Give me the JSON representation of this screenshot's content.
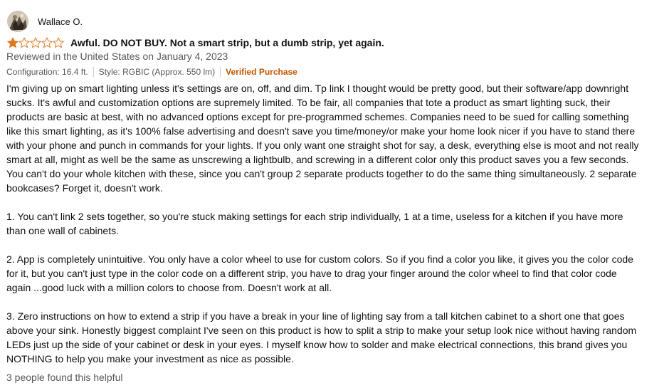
{
  "review": {
    "author": "Wallace O.",
    "rating": 1,
    "max_rating": 5,
    "star_filled_color": "#de7921",
    "title": "Awful. DO NOT BUY. Not a smart strip, but a dumb strip, yet again.",
    "date_line": "Reviewed in the United States on January 4, 2023",
    "configuration": "Configuration: 16.4 ft.",
    "style": "Style: RGBIC (Approx. 550 lm)",
    "verified": "Verified Purchase",
    "verified_color": "#c45500",
    "paragraphs": [
      "I'm giving up on smart lighting unless it's settings are on, off, and dim. Tp link I thought would be pretty good, but their software/app downright sucks. It's awful and customization options are supremely limited. To be fair, all companies that tote a product as smart lighting suck, their products are basic at best, with no advanced options except for pre-programmed schemes. Companies need to be sued for calling something like this smart lighting, as it's 100% false advertising and doesn't save you time/money/or make your home look nicer if you have to stand there with your phone and punch in commands for your lights. If you only want one straight shot for say, a desk, everything else is moot and not really smart at all, might as well be the same as unscrewing a lightbulb, and screwing in a different color only this product saves you a few seconds. You can't do your whole kitchen with these, since you can't group 2 separate products together to do the same thing simultaneously. 2 separate bookcases? Forget it, doesn't work.",
      "1. You can't link 2 sets together, so you're stuck making settings for each strip individually, 1 at a time, useless for a kitchen if you have more than one wall of cabinets.",
      "2. App is completely unintuitive. You only have a color wheel to use for custom colors. So if you find a color you like, it gives you the color code for it, but you can't just type in the color code on a different strip, you have to drag your finger around the color wheel to find that color code again ...good luck with a million colors to choose from. Doesn't work at all.",
      "3. Zero instructions on how to extend a strip if you have a break in your line of lighting say from a tall kitchen cabinet to a short one that goes above your sink. Honestly biggest complaint I've seen on this product is how to split a strip to make your setup look nice without having random LEDs just up the side of your cabinet or desk in your eyes. I myself know how to solder and make electrical connections, this brand gives you NOTHING to help you make your investment as nice as possible."
    ],
    "helpful_text": "3 people found this helpful"
  }
}
